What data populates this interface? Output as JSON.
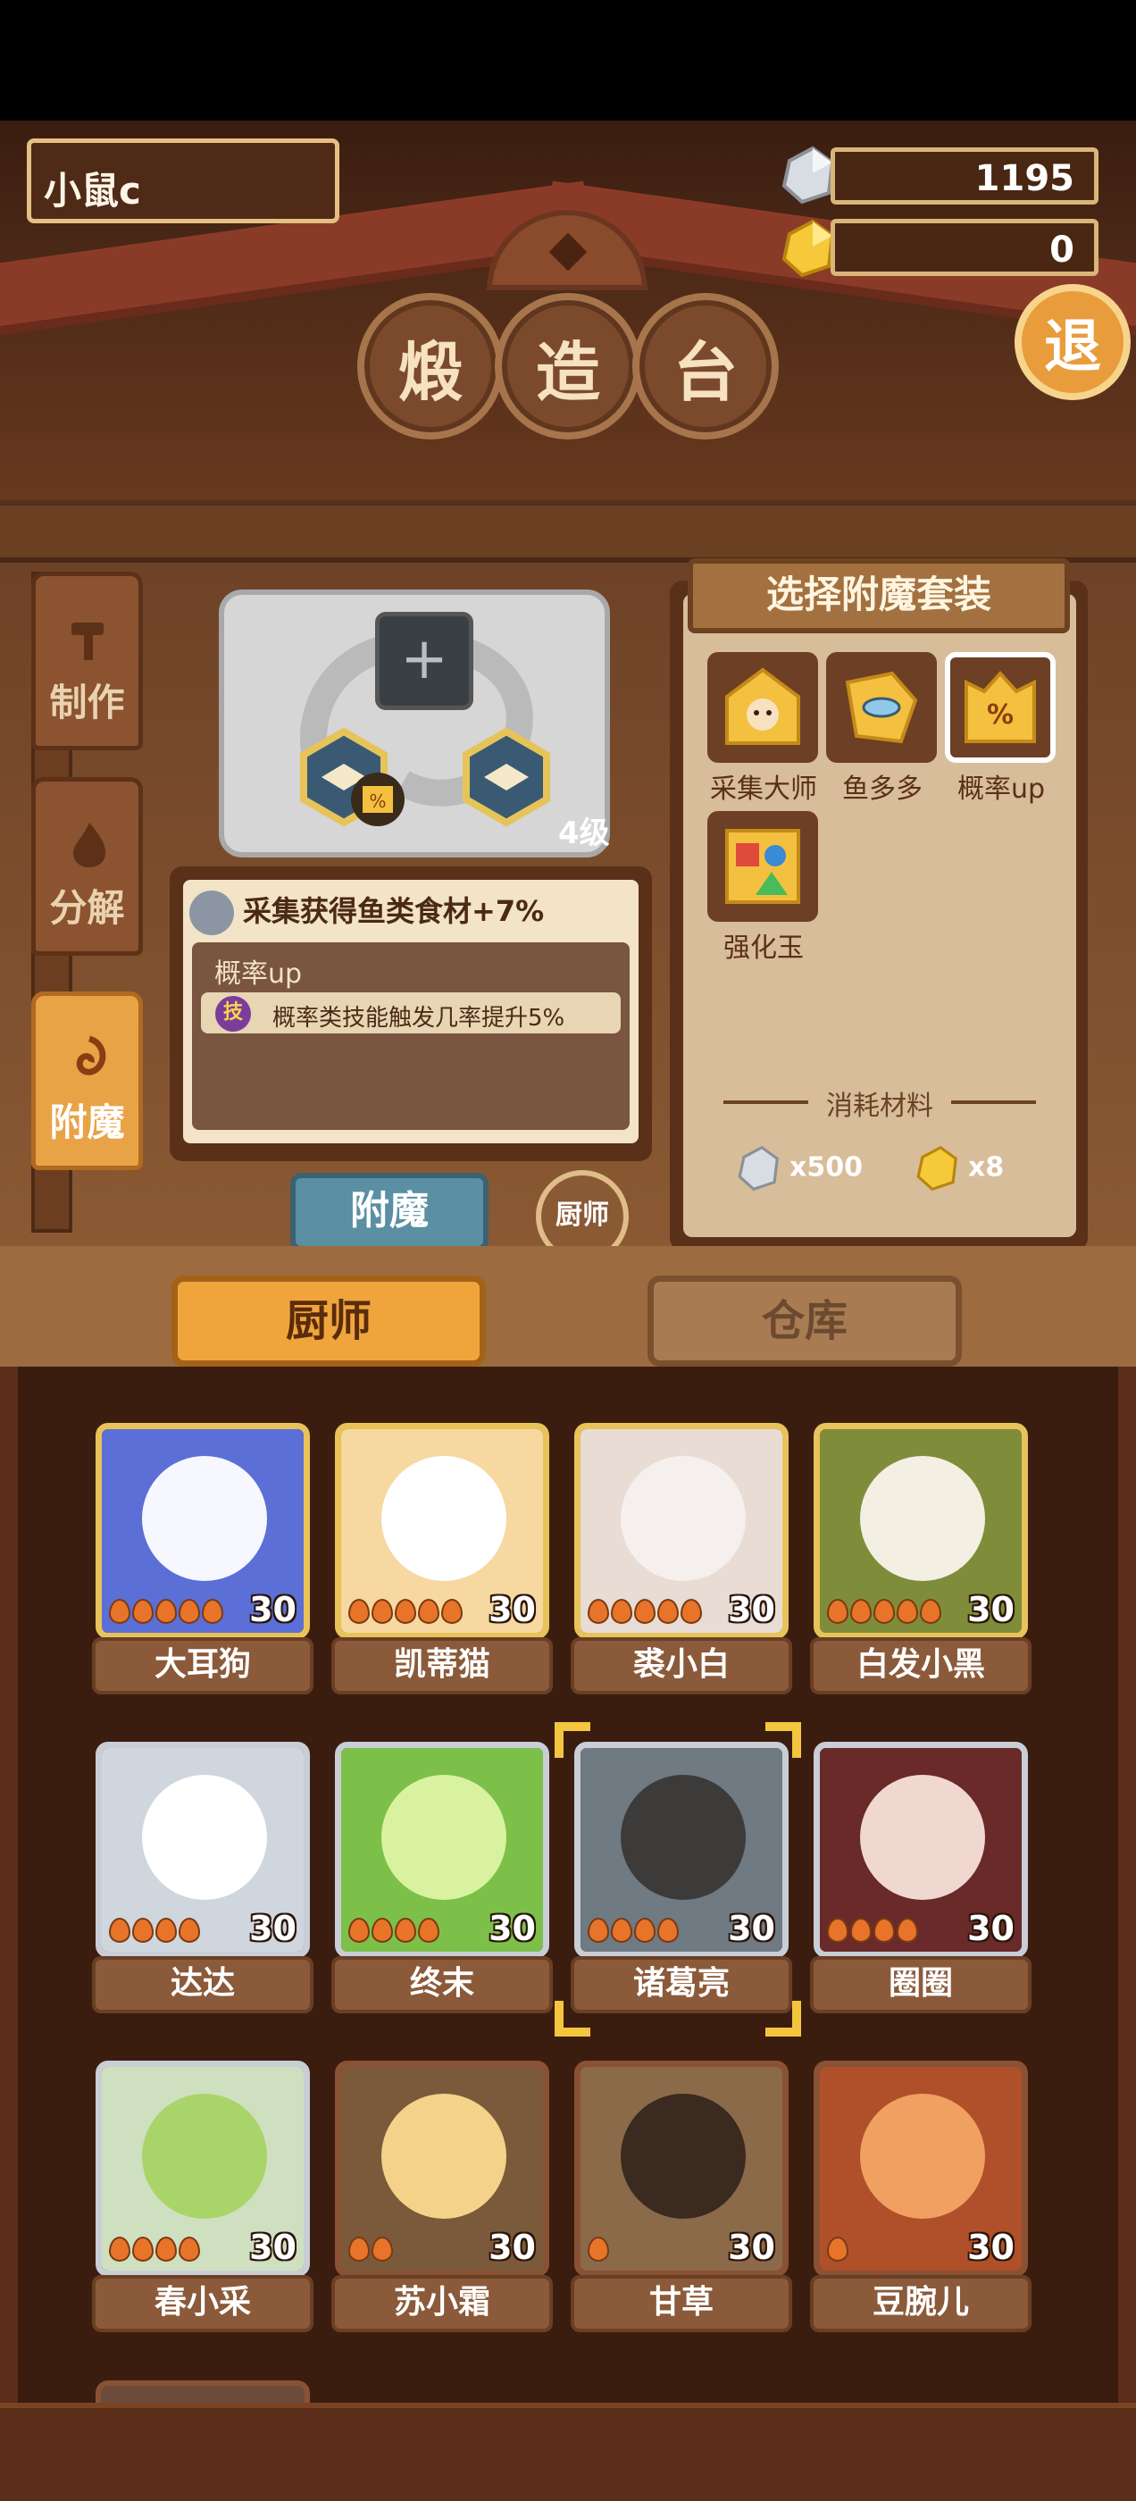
{
  "player": {
    "name": "小鼠c"
  },
  "resources": [
    {
      "icon": "silver-ore-icon",
      "value": "1195"
    },
    {
      "icon": "gold-ore-icon",
      "value": "0"
    }
  ],
  "title_chars": [
    "煅",
    "造",
    "台"
  ],
  "exit_label": "退",
  "side_tabs": [
    {
      "label": "制作",
      "icon": "hammer-icon",
      "active": false
    },
    {
      "label": "分解",
      "icon": "flame-icon",
      "active": false
    },
    {
      "label": "附魔",
      "icon": "swirl-icon",
      "active": true
    }
  ],
  "slot": {
    "level": "4级"
  },
  "info": {
    "effect": "采集获得鱼类食材+7%",
    "set_name": "概率up",
    "skill_badge": "技",
    "skill_desc": "概率类技能触发几率提升5%"
  },
  "buttons": {
    "enchant": "附魔",
    "chef": "厨师"
  },
  "set_panel": {
    "title": "选择附魔套装",
    "items": [
      {
        "label": "采集大师",
        "icon": "gather-master-icon",
        "selected": false
      },
      {
        "label": "鱼多多",
        "icon": "fish-icon",
        "selected": false
      },
      {
        "label": "概率up",
        "icon": "percent-icon",
        "selected": true
      },
      {
        "label": "强化玉",
        "icon": "shapes-icon",
        "selected": false
      }
    ],
    "materials_title": "消耗材料",
    "materials": [
      {
        "icon": "silver-ore-icon",
        "amount": "x500"
      },
      {
        "icon": "gold-ore-icon",
        "amount": "x8"
      }
    ]
  },
  "tabs": {
    "chef": "厨师",
    "warehouse": "仓库"
  },
  "chefs": [
    {
      "name": "大耳狗",
      "level": "30",
      "stars": 5,
      "rarity": "gold"
    },
    {
      "name": "凯蒂猫",
      "level": "30",
      "stars": 5,
      "rarity": "gold"
    },
    {
      "name": "裘小白",
      "level": "30",
      "stars": 5,
      "rarity": "gold"
    },
    {
      "name": "白发小黑",
      "level": "30",
      "stars": 5,
      "rarity": "gold"
    },
    {
      "name": "达达",
      "level": "30",
      "stars": 4,
      "rarity": "silver"
    },
    {
      "name": "终末",
      "level": "30",
      "stars": 4,
      "rarity": "silver"
    },
    {
      "name": "诸葛亮",
      "level": "30",
      "stars": 4,
      "rarity": "silver",
      "selected": true
    },
    {
      "name": "圈圈",
      "level": "30",
      "stars": 4,
      "rarity": "silver"
    },
    {
      "name": "春小采",
      "level": "30",
      "stars": 4,
      "rarity": "silver"
    },
    {
      "name": "苏小霜",
      "level": "30",
      "stars": 2,
      "rarity": "bronze"
    },
    {
      "name": "甘草",
      "level": "30",
      "stars": 1,
      "rarity": "bronze"
    },
    {
      "name": "豆腕儿",
      "level": "30",
      "stars": 1,
      "rarity": "bronze"
    }
  ],
  "colors": {
    "accent": "#f0a53c",
    "gold": "#e8c35a",
    "panel": "#d7bd99"
  }
}
